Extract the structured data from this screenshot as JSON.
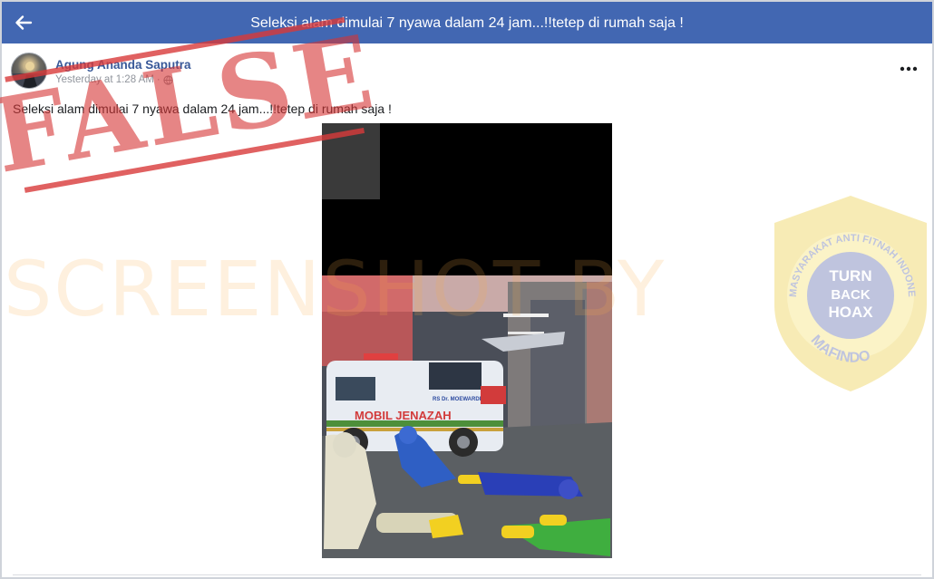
{
  "header": {
    "back_icon": "arrow-left-icon",
    "title": "Seleksi alam dimulai 7 nyawa dalam 24 jam...!!tetep di rumah saja !"
  },
  "post": {
    "author": "Agung Ananda Saputra",
    "timestamp": "Yesterday at 1:28 AM",
    "separator": "·",
    "privacy_icon": "globe-icon",
    "more_icon": "more-dots-icon",
    "text": "Seleksi alam dimulai 7 nyawa dalam 24 jam...!!tetep di rumah saja !",
    "photo": {
      "ambulance_label": "MOBIL JENAZAH",
      "ambulance_hospital": "RS Dr. MOEWARDI"
    }
  },
  "overlay": {
    "stamp": "FALSE",
    "watermark": "SCREENSHOT BY",
    "badge": {
      "ring_text": "MASYARAKAT ANTI FITNAH INDONESIA",
      "center_lines": [
        "TURN",
        "BACK",
        "HOAX"
      ],
      "bottom_text": "MAFINDO"
    }
  },
  "colors": {
    "header_bg": "#4267b2",
    "author_link": "#385898",
    "stamp_red": "#d93a3a",
    "badge_gold": "#e7c21c"
  }
}
